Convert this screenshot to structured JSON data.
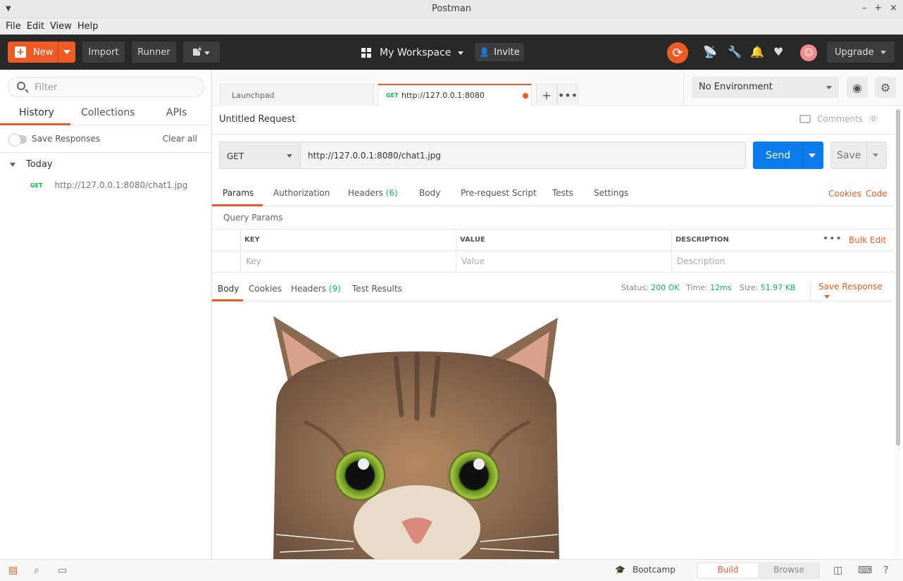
{
  "window": {
    "title": "Postman",
    "controls": [
      "–",
      "+",
      "×"
    ]
  },
  "menu": [
    "File",
    "Edit",
    "View",
    "Help"
  ],
  "header": {
    "new_label": "New",
    "import_label": "Import",
    "runner_label": "Runner",
    "workspace_label": "My Workspace",
    "invite_label": "Invite",
    "upgrade_label": "Upgrade",
    "accent": "#ef5b25"
  },
  "sidebar": {
    "filter_placeholder": "Filter",
    "tabs": [
      "History",
      "Collections",
      "APIs"
    ],
    "save_responses_label": "Save Responses",
    "clear_all_label": "Clear all",
    "group_label": "Today",
    "history": [
      {
        "method": "GET",
        "url": "http://127.0.0.1:8080/chat1.jpg"
      }
    ]
  },
  "tabs": {
    "launchpad_label": "Launchpad",
    "active": {
      "method": "GET",
      "url": "http://127.0.0.1:8080"
    }
  },
  "environment": {
    "selected": "No Environment"
  },
  "request": {
    "title": "Untitled Request",
    "comments_label": "Comments",
    "comments_count": "0",
    "method": "GET",
    "url": "http://127.0.0.1:8080/chat1.jpg",
    "send_label": "Send",
    "save_label": "Save",
    "tabs": {
      "params": "Params",
      "authorization": "Authorization",
      "headers": "Headers",
      "headers_count": "(6)",
      "body": "Body",
      "prerequest": "Pre-request Script",
      "tests": "Tests",
      "settings": "Settings"
    },
    "cookies_link": "Cookies",
    "code_link": "Code"
  },
  "query_params": {
    "title": "Query Params",
    "headers": {
      "key": "KEY",
      "value": "VALUE",
      "description": "DESCRIPTION"
    },
    "placeholders": {
      "key": "Key",
      "value": "Value",
      "description": "Description"
    },
    "bulk_edit_label": "Bulk Edit"
  },
  "response": {
    "tabs": {
      "body": "Body",
      "cookies": "Cookies",
      "headers": "Headers",
      "headers_count": "(9)",
      "test_results": "Test Results"
    },
    "status_label": "Status:",
    "status_value": "200 OK",
    "time_label": "Time:",
    "time_value": "12ms",
    "size_label": "Size:",
    "size_value": "51.97 KB",
    "save_response_label": "Save Response",
    "body_image": "cat-photo"
  },
  "statusbar": {
    "bootcamp_label": "Bootcamp",
    "build_label": "Build",
    "browse_label": "Browse"
  }
}
